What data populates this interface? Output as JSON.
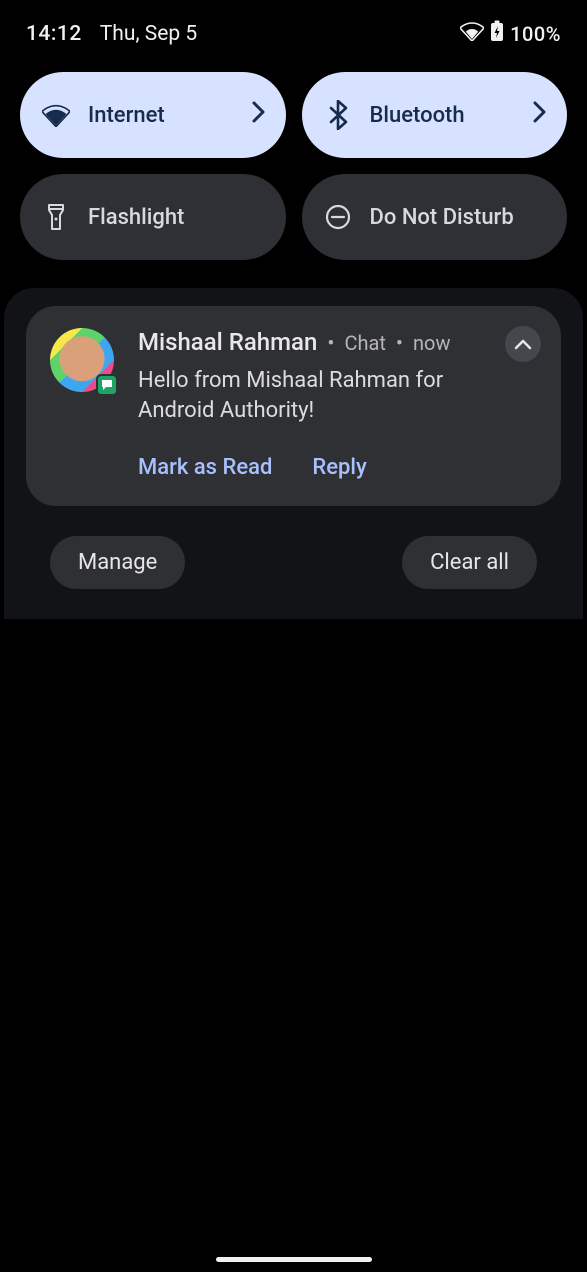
{
  "status": {
    "time": "14:12",
    "date": "Thu, Sep 5",
    "battery": "100%"
  },
  "qs": {
    "internet": "Internet",
    "bluetooth": "Bluetooth",
    "flashlight": "Flashlight",
    "dnd": "Do Not Disturb"
  },
  "notification": {
    "sender": "Mishaal Rahman",
    "app": "Chat",
    "time": "now",
    "message": "Hello from Mishaal Rahman for Android Authority!",
    "action_mark_read": "Mark as Read",
    "action_reply": "Reply"
  },
  "footer": {
    "manage": "Manage",
    "clear_all": "Clear all"
  }
}
